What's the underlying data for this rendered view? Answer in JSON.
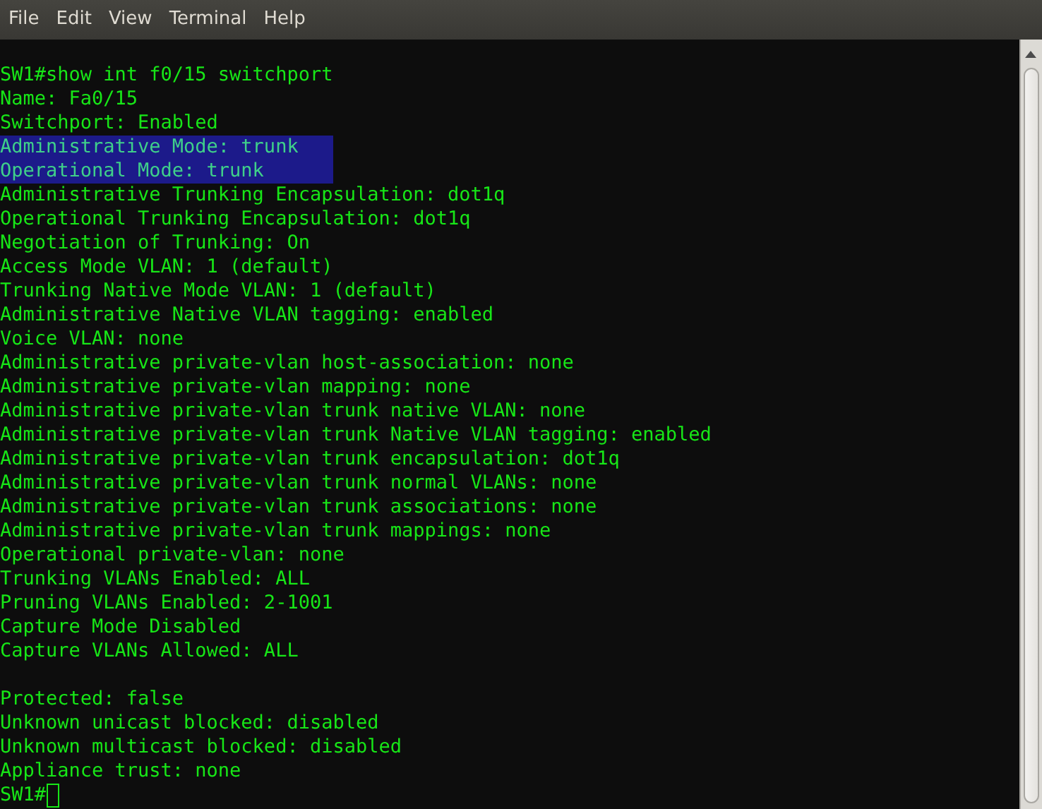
{
  "menu": [
    "File",
    "Edit",
    "View",
    "Terminal",
    "Help"
  ],
  "lines": [
    {
      "kind": "text",
      "text": "SW1#show int f0/15 switchport",
      "selected": false
    },
    {
      "kind": "text",
      "text": "Name: Fa0/15",
      "selected": false
    },
    {
      "kind": "text",
      "text": "Switchport: Enabled",
      "selected": false
    },
    {
      "kind": "text",
      "text": "Administrative Mode: trunk",
      "selected": true
    },
    {
      "kind": "text",
      "text": "Operational Mode: trunk",
      "selected": true
    },
    {
      "kind": "text",
      "text": "Administrative Trunking Encapsulation: dot1q",
      "selected": false
    },
    {
      "kind": "text",
      "text": "Operational Trunking Encapsulation: dot1q",
      "selected": false
    },
    {
      "kind": "text",
      "text": "Negotiation of Trunking: On",
      "selected": false
    },
    {
      "kind": "text",
      "text": "Access Mode VLAN: 1 (default)",
      "selected": false
    },
    {
      "kind": "text",
      "text": "Trunking Native Mode VLAN: 1 (default)",
      "selected": false
    },
    {
      "kind": "text",
      "text": "Administrative Native VLAN tagging: enabled",
      "selected": false
    },
    {
      "kind": "text",
      "text": "Voice VLAN: none",
      "selected": false
    },
    {
      "kind": "text",
      "text": "Administrative private-vlan host-association: none",
      "selected": false
    },
    {
      "kind": "text",
      "text": "Administrative private-vlan mapping: none",
      "selected": false
    },
    {
      "kind": "text",
      "text": "Administrative private-vlan trunk native VLAN: none",
      "selected": false
    },
    {
      "kind": "text",
      "text": "Administrative private-vlan trunk Native VLAN tagging: enabled",
      "selected": false
    },
    {
      "kind": "text",
      "text": "Administrative private-vlan trunk encapsulation: dot1q",
      "selected": false
    },
    {
      "kind": "text",
      "text": "Administrative private-vlan trunk normal VLANs: none",
      "selected": false
    },
    {
      "kind": "text",
      "text": "Administrative private-vlan trunk associations: none",
      "selected": false
    },
    {
      "kind": "text",
      "text": "Administrative private-vlan trunk mappings: none",
      "selected": false
    },
    {
      "kind": "text",
      "text": "Operational private-vlan: none",
      "selected": false
    },
    {
      "kind": "text",
      "text": "Trunking VLANs Enabled: ALL",
      "selected": false
    },
    {
      "kind": "text",
      "text": "Pruning VLANs Enabled: 2-1001",
      "selected": false
    },
    {
      "kind": "text",
      "text": "Capture Mode Disabled",
      "selected": false
    },
    {
      "kind": "text",
      "text": "Capture VLANs Allowed: ALL",
      "selected": false
    },
    {
      "kind": "blank"
    },
    {
      "kind": "text",
      "text": "Protected: false",
      "selected": false
    },
    {
      "kind": "text",
      "text": "Unknown unicast blocked: disabled",
      "selected": false
    },
    {
      "kind": "text",
      "text": "Unknown multicast blocked: disabled",
      "selected": false
    },
    {
      "kind": "text",
      "text": "Appliance trust: none",
      "selected": false
    },
    {
      "kind": "prompt",
      "text": "SW1#"
    }
  ]
}
